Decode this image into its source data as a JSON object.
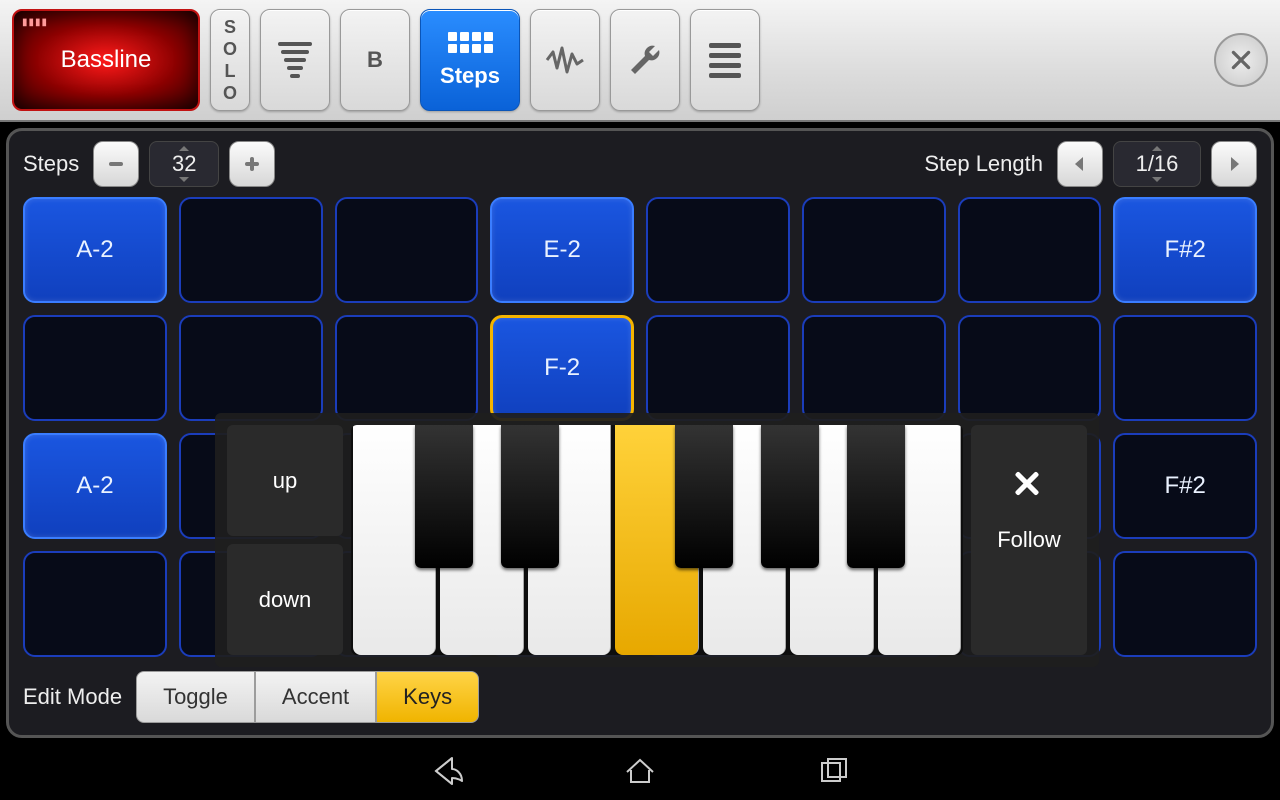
{
  "toolbar": {
    "track_name": "Bassline",
    "track_mini": "▮▮▮▮",
    "solo": [
      "S",
      "O",
      "L",
      "O"
    ],
    "pattern_label": "B",
    "steps_label": "Steps"
  },
  "controls": {
    "steps_label": "Steps",
    "steps_value": "32",
    "steplen_label": "Step Length",
    "steplen_value": "1/16"
  },
  "steps": [
    {
      "note": "A-2",
      "on": true,
      "sel": false
    },
    {
      "note": "",
      "on": false,
      "sel": false
    },
    {
      "note": "",
      "on": false,
      "sel": false
    },
    {
      "note": "E-2",
      "on": true,
      "sel": false
    },
    {
      "note": "",
      "on": false,
      "sel": false
    },
    {
      "note": "",
      "on": false,
      "sel": false
    },
    {
      "note": "",
      "on": false,
      "sel": false
    },
    {
      "note": "F#2",
      "on": true,
      "sel": false
    },
    {
      "note": "",
      "on": false,
      "sel": false
    },
    {
      "note": "",
      "on": false,
      "sel": false
    },
    {
      "note": "",
      "on": false,
      "sel": false
    },
    {
      "note": "F-2",
      "on": true,
      "sel": true
    },
    {
      "note": "",
      "on": false,
      "sel": false
    },
    {
      "note": "",
      "on": false,
      "sel": false
    },
    {
      "note": "",
      "on": false,
      "sel": false
    },
    {
      "note": "",
      "on": false,
      "sel": false
    },
    {
      "note": "A-2",
      "on": true,
      "sel": false
    },
    {
      "note": "",
      "on": false,
      "sel": false
    },
    {
      "note": "",
      "on": false,
      "sel": false
    },
    {
      "note": "",
      "on": false,
      "sel": false
    },
    {
      "note": "",
      "on": false,
      "sel": false
    },
    {
      "note": "",
      "on": false,
      "sel": false
    },
    {
      "note": "",
      "on": false,
      "sel": false
    },
    {
      "note": "F#2",
      "on": false,
      "sel": false
    },
    {
      "note": "",
      "on": false,
      "sel": false
    },
    {
      "note": "",
      "on": false,
      "sel": false
    },
    {
      "note": "",
      "on": false,
      "sel": false
    },
    {
      "note": "",
      "on": false,
      "sel": false
    },
    {
      "note": "",
      "on": false,
      "sel": false
    },
    {
      "note": "",
      "on": false,
      "sel": false
    },
    {
      "note": "",
      "on": false,
      "sel": false
    },
    {
      "note": "",
      "on": false,
      "sel": false
    }
  ],
  "popup": {
    "up": "up",
    "down": "down",
    "follow": "Follow",
    "white_highlight_index": 3,
    "whites_count": 7,
    "blacks": [
      10.5,
      24.5,
      53.0,
      67.0,
      81.0
    ]
  },
  "edit": {
    "label": "Edit Mode",
    "modes": [
      {
        "label": "Toggle",
        "active": false
      },
      {
        "label": "Accent",
        "active": false
      },
      {
        "label": "Keys",
        "active": true
      }
    ]
  }
}
